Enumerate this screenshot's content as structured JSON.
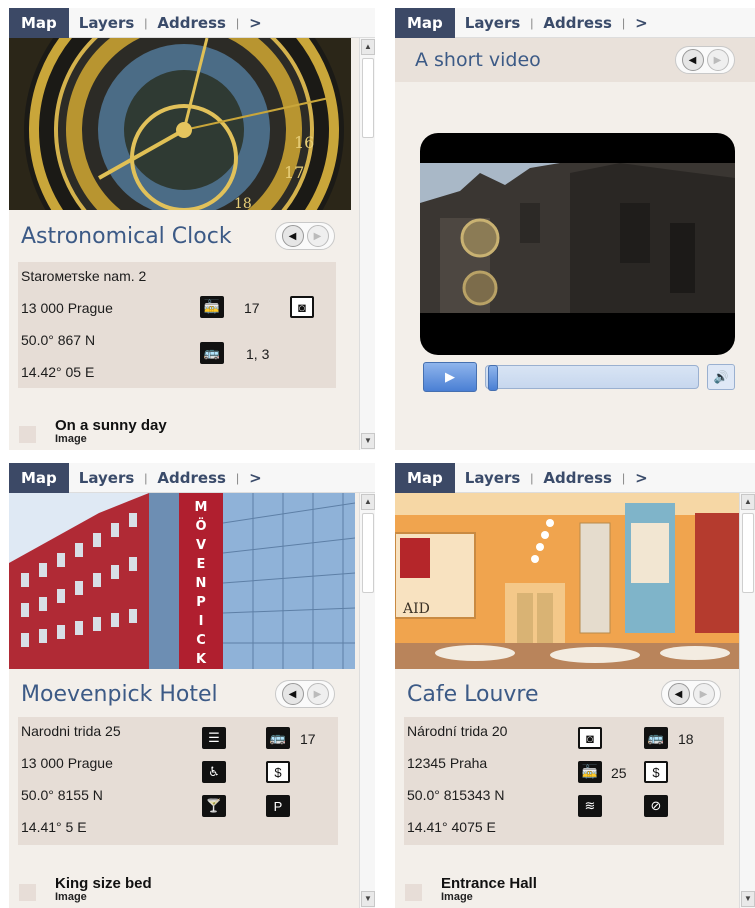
{
  "tabs": [
    {
      "label": "Map"
    },
    {
      "label": "Layers"
    },
    {
      "label": "Address"
    },
    {
      "label": ">"
    }
  ],
  "nav_buttons": {
    "prev_icon": "◀",
    "next_icon": "▶"
  },
  "scroll": {
    "up": "▲",
    "down": "▼"
  },
  "panels": {
    "clock": {
      "title": "Astronomical Clock",
      "address": [
        "Staroметske nam. 2",
        "13 000 Prague",
        "50.0° 867 N",
        "14.42° 05 E"
      ],
      "tram_number": "17",
      "bus_number": "1, 3",
      "caption_title": "On a sunny day",
      "caption_type": "Image"
    },
    "video": {
      "title": "A short video",
      "play_icon": "▶",
      "volume_icon": "🔊"
    },
    "hotel": {
      "title": "Moevenpick Hotel",
      "address": [
        "Narodni trida 25",
        "13 000 Prague",
        "50.0° 8155 N",
        "14.41° 5 E"
      ],
      "bus_number": "17",
      "sign_text": "MÖVENPICK",
      "caption_title": "King size bed",
      "caption_type": "Image"
    },
    "cafe": {
      "title": "Cafe Louvre",
      "address": [
        "Národní trida 20",
        "12345 Praha",
        "50.0° 815343 N",
        "14.41° 4075 E"
      ],
      "bus_number": "18",
      "tram_number": "25",
      "caption_title": "Entrance Hall",
      "caption_type": "Image"
    }
  }
}
